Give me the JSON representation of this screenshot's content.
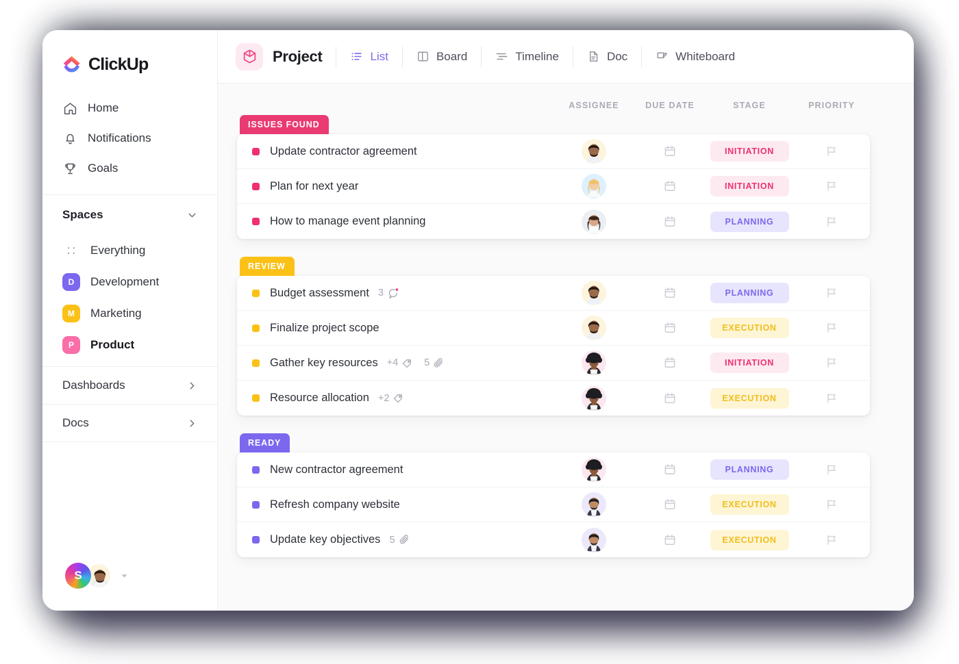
{
  "brand": {
    "name": "ClickUp",
    "logo_icon": "clickup-logo-icon"
  },
  "sidebar": {
    "nav": [
      {
        "label": "Home",
        "icon": "home-icon"
      },
      {
        "label": "Notifications",
        "icon": "bell-icon"
      },
      {
        "label": "Goals",
        "icon": "trophy-icon"
      }
    ],
    "spaces_header": {
      "label": "Spaces",
      "icon": "chevron-down-icon"
    },
    "spaces": [
      {
        "label": "Everything",
        "icon": "grid-icon",
        "initial": "",
        "color": "",
        "active": false
      },
      {
        "label": "Development",
        "icon": "space-avatar",
        "initial": "D",
        "color": "#7b68ee",
        "active": false
      },
      {
        "label": "Marketing",
        "icon": "space-avatar",
        "initial": "M",
        "color": "#fbc117",
        "active": false
      },
      {
        "label": "Product",
        "icon": "space-avatar",
        "initial": "P",
        "color": "#fb6ea8",
        "active": true
      }
    ],
    "links": [
      {
        "label": "Dashboards",
        "icon": "chevron-right-icon"
      },
      {
        "label": "Docs",
        "icon": "chevron-right-icon"
      }
    ],
    "user": {
      "workspace_initial": "S",
      "avatar": "user-avatar",
      "caret_icon": "caret-down-icon"
    }
  },
  "topbar": {
    "project_icon": "cube-icon",
    "project_title": "Project",
    "views": [
      {
        "label": "List",
        "icon": "list-icon",
        "active": true
      },
      {
        "label": "Board",
        "icon": "board-icon",
        "active": false
      },
      {
        "label": "Timeline",
        "icon": "timeline-icon",
        "active": false
      },
      {
        "label": "Doc",
        "icon": "doc-icon",
        "active": false
      },
      {
        "label": "Whiteboard",
        "icon": "whiteboard-icon",
        "active": false
      }
    ]
  },
  "columns": {
    "assignee": "ASSIGNEE",
    "due_date": "DUE DATE",
    "stage": "STAGE",
    "priority": "PRIORITY"
  },
  "groups": [
    {
      "label": "ISSUES FOUND",
      "color": "#ea3a72",
      "dot_color": "#f0306f",
      "tasks": [
        {
          "name": "Update contractor agreement",
          "stage": "INITIATION",
          "stage_class": "pill-initiation",
          "avatar": "avatar-beard-yellow",
          "comments": "",
          "tags": "",
          "attachments": ""
        },
        {
          "name": "Plan for next year",
          "stage": "INITIATION",
          "stage_class": "pill-initiation",
          "avatar": "avatar-blonde-blue",
          "comments": "",
          "tags": "",
          "attachments": ""
        },
        {
          "name": "How to manage event planning",
          "stage": "PLANNING",
          "stage_class": "pill-planning",
          "avatar": "avatar-woman-gray",
          "comments": "",
          "tags": "",
          "attachments": ""
        }
      ]
    },
    {
      "label": "REVIEW",
      "color": "#fbc117",
      "dot_color": "#fbc117",
      "tasks": [
        {
          "name": "Budget assessment",
          "stage": "PLANNING",
          "stage_class": "pill-planning",
          "avatar": "avatar-beard-yellow",
          "comments": "3",
          "tags": "",
          "attachments": ""
        },
        {
          "name": "Finalize project scope",
          "stage": "EXECUTION",
          "stage_class": "pill-execution",
          "avatar": "avatar-beard-yellow",
          "comments": "",
          "tags": "",
          "attachments": ""
        },
        {
          "name": "Gather key resources",
          "stage": "INITIATION",
          "stage_class": "pill-initiation",
          "avatar": "avatar-afro-pink",
          "comments": "",
          "tags": "+4",
          "attachments": "5"
        },
        {
          "name": "Resource allocation",
          "stage": "EXECUTION",
          "stage_class": "pill-execution",
          "avatar": "avatar-afro-pink",
          "comments": "",
          "tags": "+2",
          "attachments": ""
        }
      ]
    },
    {
      "label": "READY",
      "color": "#7b68ee",
      "dot_color": "#7b68ee",
      "tasks": [
        {
          "name": "New contractor agreement",
          "stage": "PLANNING",
          "stage_class": "pill-planning",
          "avatar": "avatar-afro-pink",
          "comments": "",
          "tags": "",
          "attachments": ""
        },
        {
          "name": "Refresh company website",
          "stage": "EXECUTION",
          "stage_class": "pill-execution",
          "avatar": "avatar-man-lavender",
          "comments": "",
          "tags": "",
          "attachments": ""
        },
        {
          "name": "Update key objectives",
          "stage": "EXECUTION",
          "stage_class": "pill-execution",
          "avatar": "avatar-man-lavender",
          "comments": "",
          "tags": "",
          "attachments": "5"
        }
      ]
    }
  ],
  "icons": {
    "comment": "comment-bubble-icon",
    "tag": "tag-icon",
    "attachment": "paperclip-icon",
    "calendar": "calendar-icon",
    "flag": "flag-icon"
  },
  "colors": {
    "accent_purple": "#7b68ee",
    "accent_pink": "#ea3a72",
    "accent_yellow": "#fbc117"
  }
}
